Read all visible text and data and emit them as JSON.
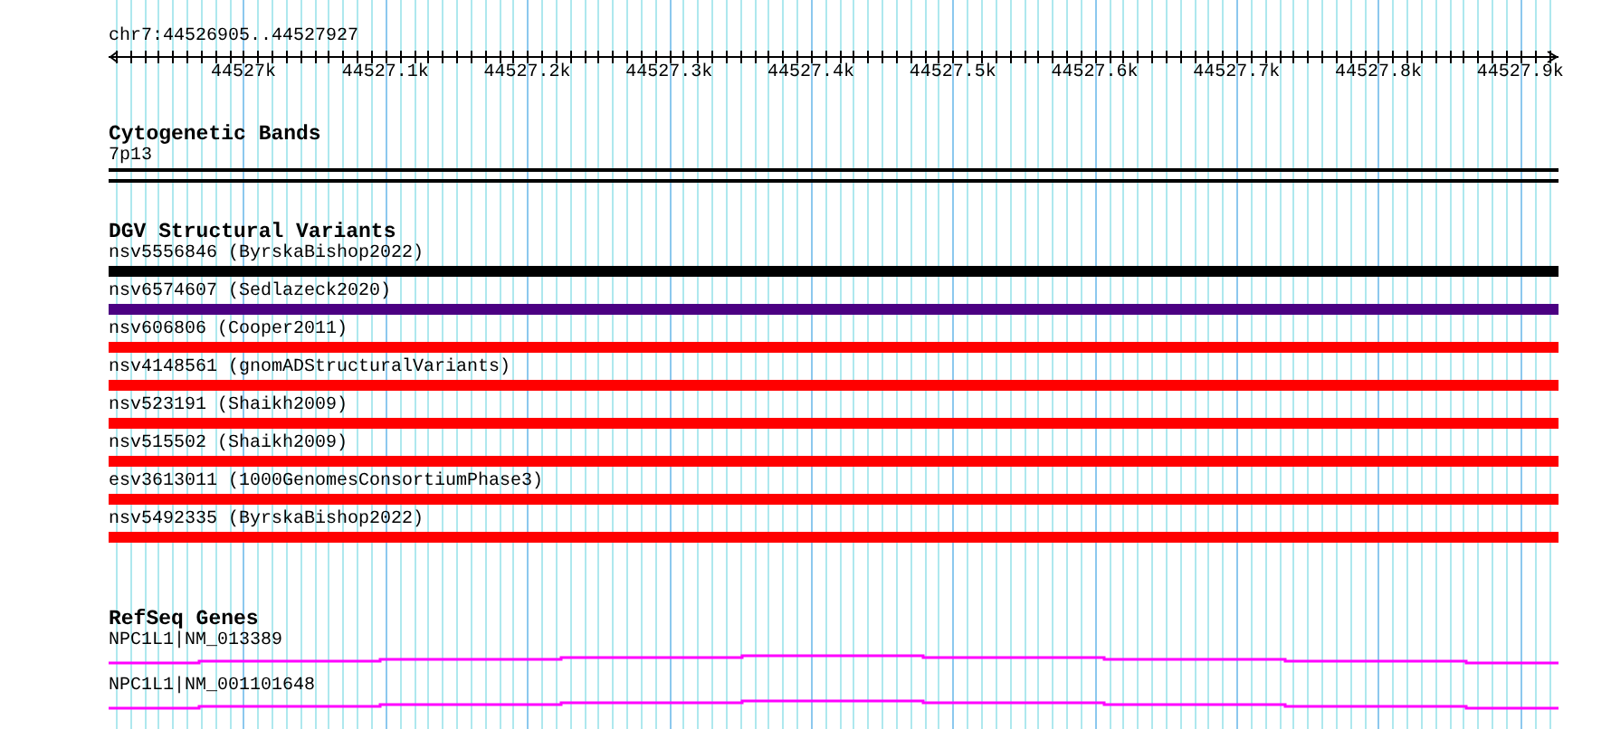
{
  "position": "chr7:44526905..44527927",
  "ruler": {
    "ticks": [
      "44527k",
      "44527.1k",
      "44527.2k",
      "44527.3k",
      "44527.4k",
      "44527.5k",
      "44527.6k",
      "44527.7k",
      "44527.8k",
      "44527.9k"
    ]
  },
  "tracks": [
    {
      "title": "Cytogenetic Bands",
      "kind": "bands",
      "items": [
        {
          "label": "7p13"
        }
      ]
    },
    {
      "title": "DGV Structural Variants",
      "kind": "variants",
      "items": [
        {
          "label": "nsv5556846 (ByrskaBishop2022)",
          "color": "#000000"
        },
        {
          "label": "nsv6574607 (Sedlazeck2020)",
          "color": "#4b0082"
        },
        {
          "label": "nsv606806 (Cooper2011)",
          "color": "#ff0000"
        },
        {
          "label": "nsv4148561 (gnomADStructuralVariants)",
          "color": "#ff0000"
        },
        {
          "label": "nsv523191 (Shaikh2009)",
          "color": "#ff0000"
        },
        {
          "label": "nsv515502 (Shaikh2009)",
          "color": "#ff0000"
        },
        {
          "label": "esv3613011 (1000GenomesConsortiumPhase3)",
          "color": "#ff0000"
        },
        {
          "label": "nsv5492335 (ByrskaBishop2022)",
          "color": "#ff0000"
        }
      ]
    },
    {
      "title": "RefSeq Genes",
      "kind": "genes",
      "items": [
        {
          "label": "NPC1L1|NM_013389"
        },
        {
          "label": "NPC1L1|NM_001101648"
        }
      ]
    }
  ]
}
